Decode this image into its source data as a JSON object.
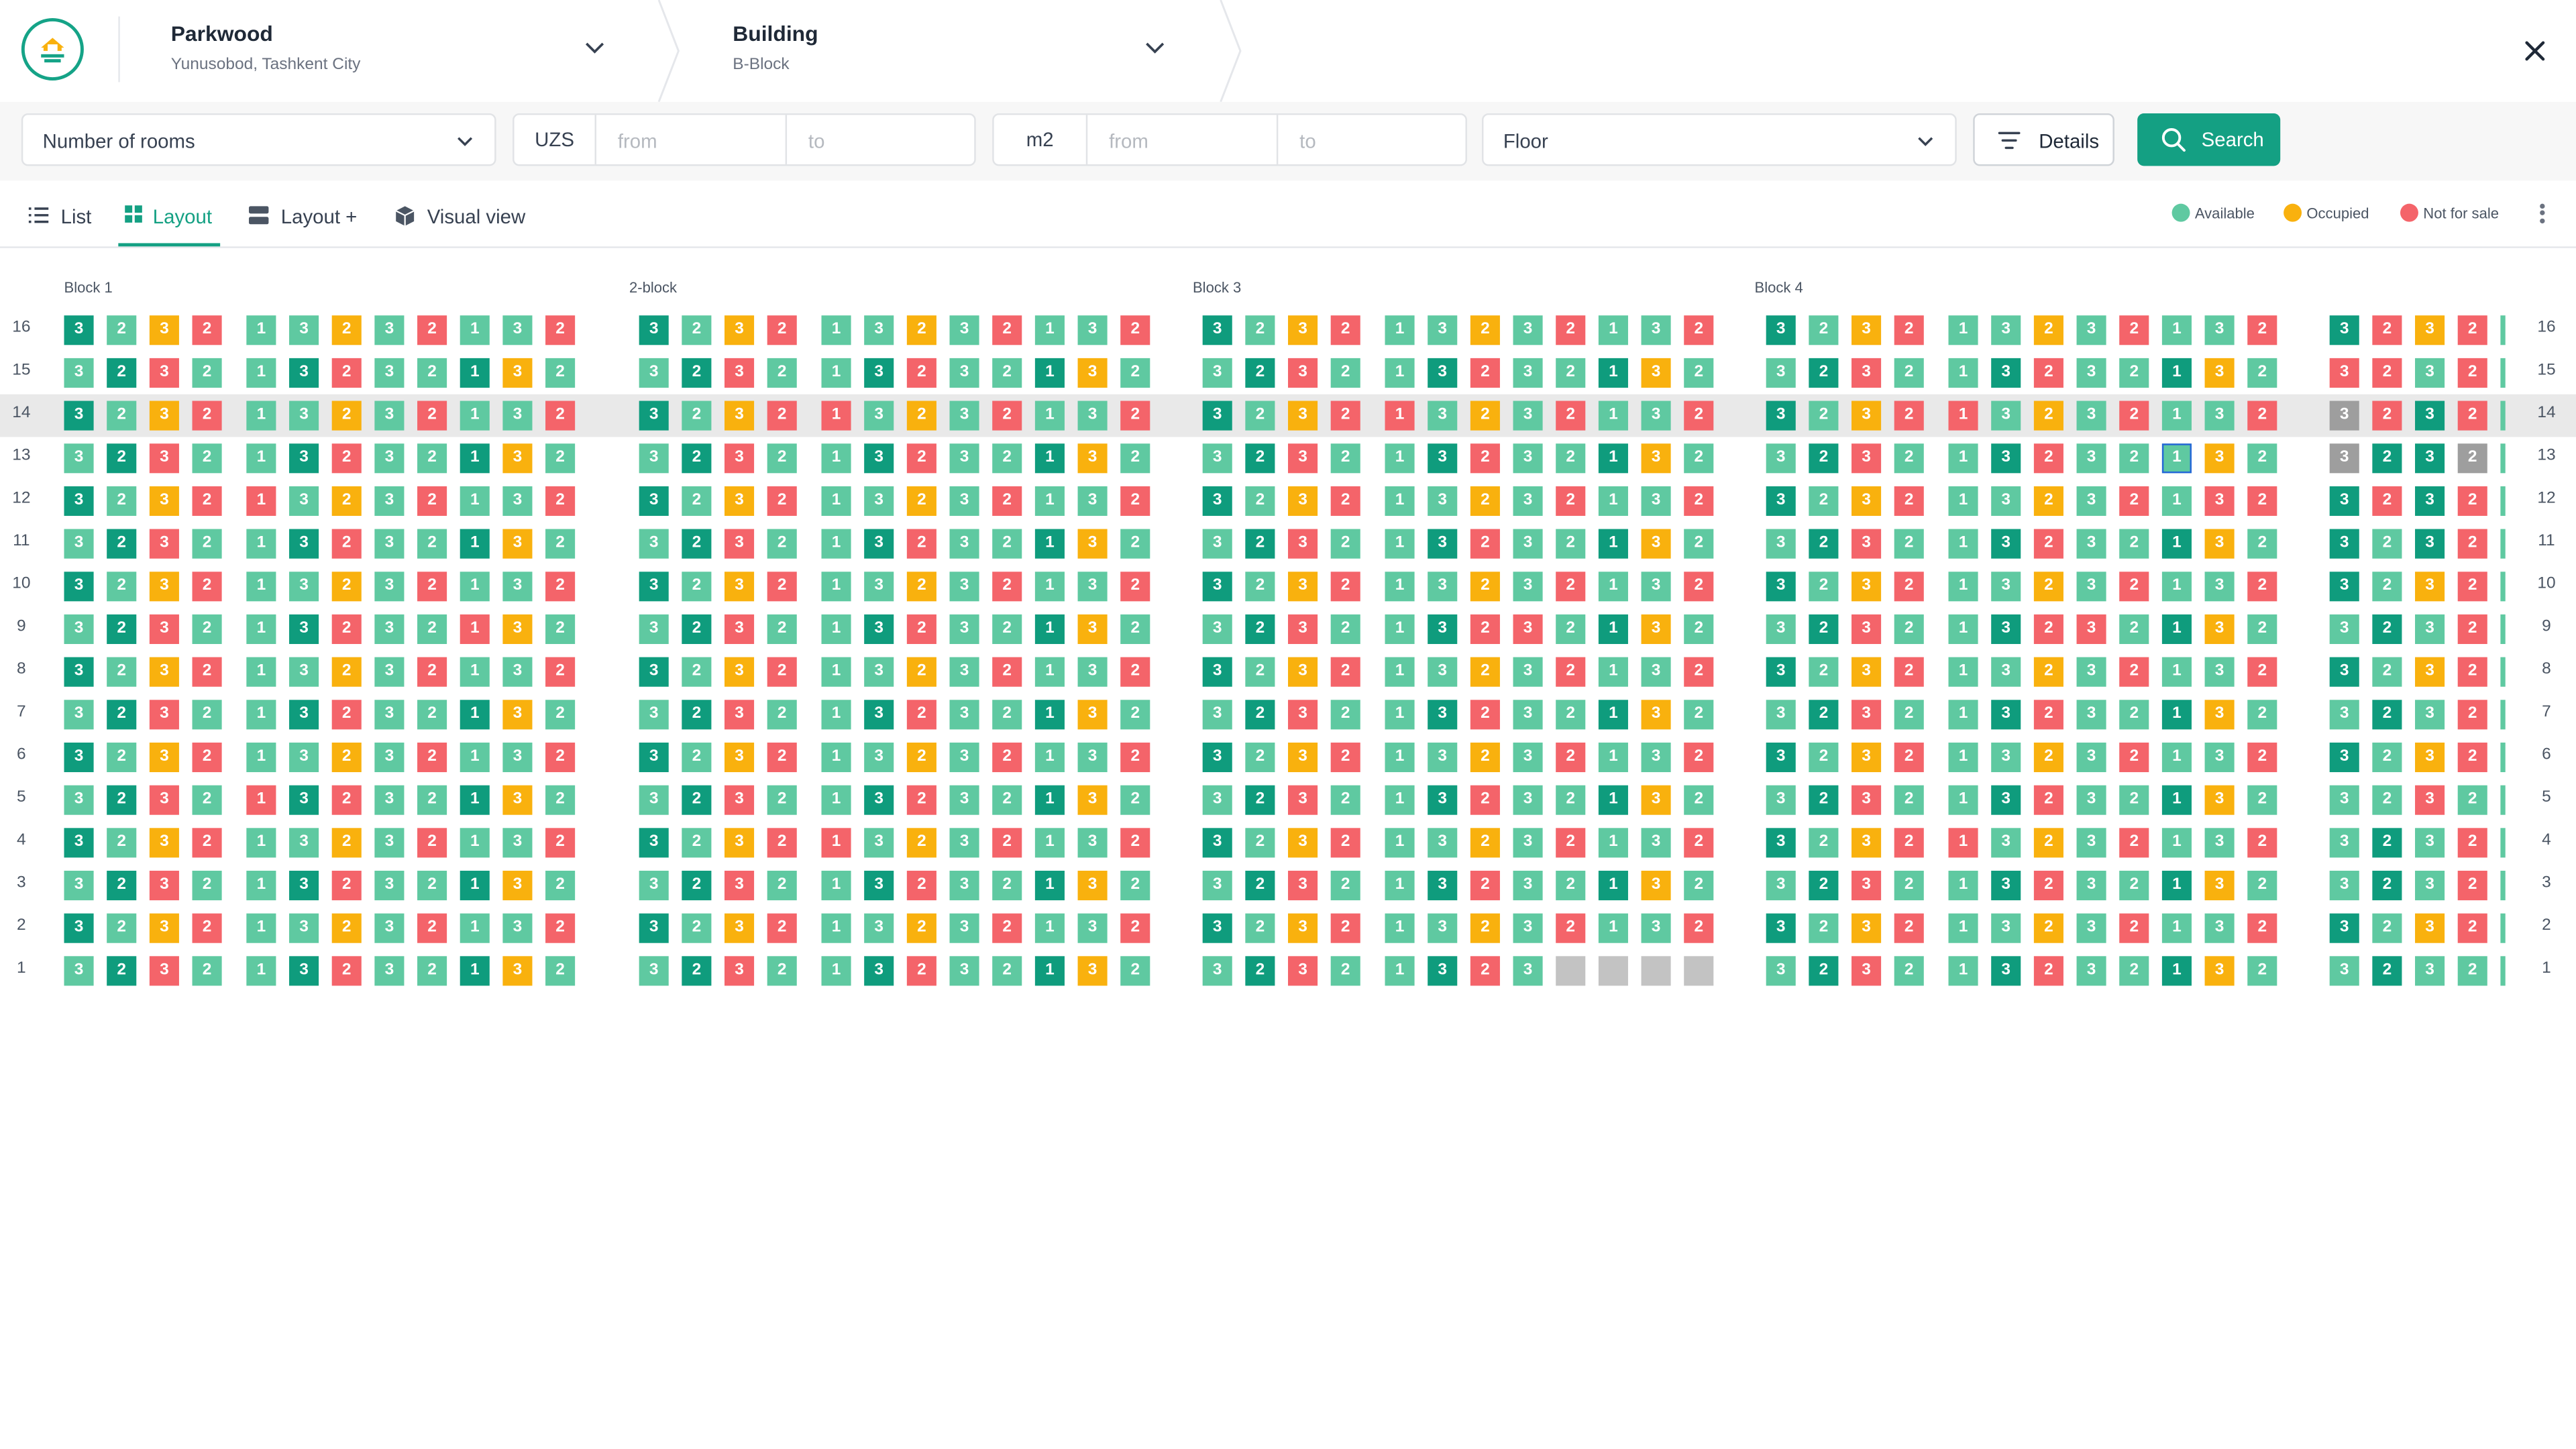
{
  "header": {
    "project": {
      "title": "Parkwood",
      "subtitle": "Yunusobod, Tashkent City"
    },
    "building": {
      "title": "Building",
      "subtitle": "B-Block"
    }
  },
  "filters": {
    "rooms_label": "Number of rooms",
    "price_unit": "UZS",
    "price_from": "from",
    "price_to": "to",
    "area_unit": "m2",
    "area_from": "from",
    "area_to": "to",
    "floor_label": "Floor",
    "details_label": "Details",
    "search_label": "Search"
  },
  "tabs": [
    {
      "label": "List",
      "active": false
    },
    {
      "label": "Layout",
      "active": true
    },
    {
      "label": "Layout +",
      "active": false
    },
    {
      "label": "Visual view",
      "active": false
    }
  ],
  "legend": [
    {
      "label": "Available",
      "color": "#5fc9a1"
    },
    {
      "label": "Occupied",
      "color": "#f9b10e"
    },
    {
      "label": "Not for sale",
      "color": "#f4646a"
    }
  ],
  "colors": {
    "accent": "#14a083",
    "available": "#5fc9a1",
    "available_dark": "#0f9c7d",
    "occupied": "#f9b10e",
    "not_for_sale": "#f4646a",
    "empty": "#c3c3c3"
  },
  "highlighted_floor": 14,
  "floors": [
    16,
    15,
    14,
    13,
    12,
    11,
    10,
    9,
    8,
    7,
    6,
    5,
    4,
    3,
    2,
    1
  ],
  "blocks": [
    {
      "name": "Block 1",
      "rows": [
        "3D 2A 3O 2N 1A 3A 2O 3A 2N 1A 3A 2N",
        "3A 2D 3N 2A 1A 3D 2N 3A 2A 1D 3O 2A",
        "3D 2A 3O 2N 1A 3A 2O 3A 2N 1A 3A 2N",
        "3A 2D 3N 2A 1A 3D 2N 3A 2A 1D 3O 2A",
        "3D 2A 3O 2N 1N 3A 2O 3A 2N 1A 3A 2N",
        "3A 2D 3N 2A 1A 3D 2N 3A 2A 1D 3O 2A",
        "3D 2A 3O 2N 1A 3A 2O 3A 2N 1A 3A 2N",
        "3A 2D 3N 2A 1A 3D 2N 3A 2A 1N 3O 2A",
        "3D 2A 3O 2N 1A 3A 2O 3A 2N 1A 3A 2N",
        "3A 2D 3N 2A 1A 3D 2N 3A 2A 1D 3O 2A",
        "3D 2A 3O 2N 1A 3A 2O 3A 2N 1A 3A 2N",
        "3A 2D 3N 2A 1N 3D 2N 3A 2A 1D 3O 2A",
        "3D 2A 3O 2N 1A 3A 2O 3A 2N 1A 3A 2N",
        "3A 2D 3N 2A 1A 3D 2N 3A 2A 1D 3O 2A",
        "3D 2A 3O 2N 1A 3A 2O 3A 2N 1A 3A 2N",
        "3A 2D 3N 2A 1A 3D 2N 3A 2A 1D 3O 2A"
      ]
    },
    {
      "name": "2-block",
      "rows": [
        "3D 2A 3O 2N 1A 3A 2O 3A 2N 1A 3A 2N",
        "3A 2D 3N 2A 1A 3D 2N 3A 2A 1D 3O 2A",
        "3D 2A 3O 2N 1N 3A 2O 3A 2N 1A 3A 2N",
        "3A 2D 3N 2A 1A 3D 2N 3A 2A 1D 3O 2A",
        "3D 2A 3O 2N 1A 3A 2O 3A 2N 1A 3A 2N",
        "3A 2D 3N 2A 1A 3D 2N 3A 2A 1D 3O 2A",
        "3D 2A 3O 2N 1A 3A 2O 3A 2N 1A 3A 2N",
        "3A 2D 3N 2A 1A 3D 2N 3A 2A 1D 3O 2A",
        "3D 2A 3O 2N 1A 3A 2O 3A 2N 1A 3A 2N",
        "3A 2D 3N 2A 1A 3D 2N 3A 2A 1D 3O 2A",
        "3D 2A 3O 2N 1A 3A 2O 3A 2N 1A 3A 2N",
        "3A 2D 3N 2A 1A 3D 2N 3A 2A 1D 3O 2A",
        "3D 2A 3O 2N 1N 3A 2O 3A 2N 1A 3A 2N",
        "3A 2D 3N 2A 1A 3D 2N 3A 2A 1D 3O 2A",
        "3D 2A 3O 2N 1A 3A 2O 3A 2N 1A 3A 2N",
        "3A 2D 3N 2A 1A 3D 2N 3A 2A 1D 3O 2A"
      ]
    },
    {
      "name": "Block 3",
      "rows": [
        "3D 2A 3O 2N 1A 3A 2O 3A 2N 1A 3A 2N",
        "3A 2D 3N 2A 1A 3D 2N 3A 2A 1D 3O 2A",
        "3D 2A 3O 2N 1N 3A 2O 3A 2N 1A 3A 2N",
        "3A 2D 3N 2A 1A 3D 2N 3A 2A 1D 3O 2A",
        "3D 2A 3O 2N 1A 3A 2O 3A 2N 1A 3A 2N",
        "3A 2D 3N 2A 1A 3D 2N 3A 2A 1D 3O 2A",
        "3D 2A 3O 2N 1A 3A 2O 3A 2N 1A 3A 2N",
        "3A 2D 3N 2A 1A 3D 2N 3N 2A 1D 3O 2A",
        "3D 2A 3O 2N 1A 3A 2O 3A 2N 1A 3A 2N",
        "3A 2D 3N 2A 1A 3D 2N 3A 2A 1D 3O 2A",
        "3D 2A 3O 2N 1A 3A 2O 3A 2N 1A 3A 2N",
        "3A 2D 3N 2A 1A 3D 2N 3A 2A 1D 3O 2A",
        "3D 2A 3O 2N 1A 3A 2O 3A 2N 1A 3A 2N",
        "3A 2D 3N 2A 1A 3D 2N 3A 2A 1D 3O 2A",
        "3D 2A 3O 2N 1A 3A 2O 3A 2N 1A 3A 2N",
        "3A 2D 3N 2A 1A 3D 2N 3A xG xG xG xG"
      ]
    },
    {
      "name": "Block 4",
      "rows": [
        "3D 2A 3O 2N 1A 3A 2O 3A 2N 1A 3A 2N",
        "3A 2D 3N 2A 1A 3D 2N 3A 2A 1D 3O 2A",
        "3D 2A 3O 2N 1N 3A 2O 3A 2N 1A 3A 2N",
        "3A 2D 3N 2A 1A 3D 2N 3A 2A 1A 3O 2A",
        "3D 2A 3O 2N 1A 3A 2O 3A 2N 1A 3N 2N",
        "3A 2D 3N 2A 1A 3D 2N 3A 2A 1D 3O 2A",
        "3D 2A 3O 2N 1A 3A 2O 3A 2N 1A 3A 2N",
        "3A 2D 3N 2A 1A 3D 2N 3N 2A 1D 3O 2A",
        "3D 2A 3O 2N 1A 3A 2O 3A 2N 1A 3A 2N",
        "3A 2D 3N 2A 1A 3D 2N 3A 2A 1D 3O 2A",
        "3D 2A 3O 2N 1A 3A 2O 3A 2N 1A 3A 2N",
        "3A 2D 3N 2A 1A 3D 2N 3A 2A 1D 3O 2A",
        "3D 2A 3O 2N 1N 3A 2O 3A 2N 1A 3A 2N",
        "3A 2D 3N 2A 1A 3D 2N 3A 2A 1D 3O 2A",
        "3D 2A 3O 2N 1A 3A 2O 3A 2N 1A 3A 2N",
        "3A 2D 3N 2A 1A 3D 2N 3A 2A 1D 3O 2A"
      ]
    },
    {
      "name": "",
      "rows": [
        "3D 2N 3O 2N",
        "3N 2N 3A 2N",
        "3S 2N 3D 2N",
        "3S 2D 3D 2S",
        "3D 2N 3D 2N",
        "3D 2A 3D 2N",
        "3D 2A 3O 2N",
        "3A 2D 3A 2N",
        "3D 2A 3O 2N",
        "3A 2D 3A 2N",
        "3D 2A 3O 2N",
        "3A 2A 3N 2A",
        "3A 2D 3A 2N",
        "3A 2D 3A 2N",
        "3D 2A 3O 2N",
        "3A 2D 3A 2A"
      ]
    }
  ],
  "selected_cell": {
    "block": "Block 4",
    "floor": 13,
    "rooms": "1"
  }
}
